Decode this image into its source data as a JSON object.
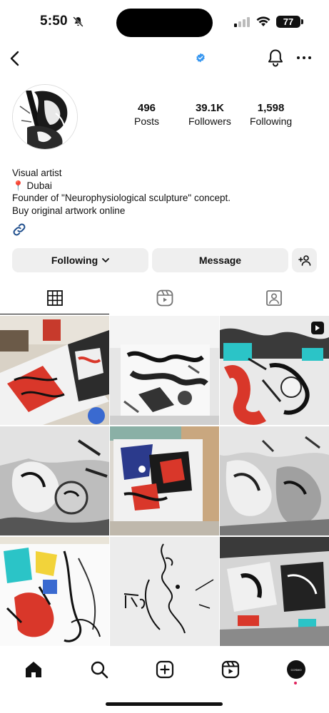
{
  "status_bar": {
    "time": "5:50",
    "battery": "77"
  },
  "profile": {
    "stats": [
      {
        "value": "496",
        "label": "Posts"
      },
      {
        "value": "39.1K",
        "label": "Followers"
      },
      {
        "value": "1,598",
        "label": "Following"
      }
    ],
    "bio": {
      "line1": "Visual artist",
      "line2": "📍 Dubai",
      "line3": "Founder of \"Neurophysiological sculpture\" concept.",
      "line4": "Buy original artwork online"
    }
  },
  "actions": {
    "following_label": "Following",
    "message_label": "Message"
  },
  "tabs": [
    {
      "icon": "grid-icon",
      "selected": true
    },
    {
      "icon": "reels-icon",
      "selected": false
    },
    {
      "icon": "tagged-icon",
      "selected": false
    }
  ],
  "posts_count_visible": 9,
  "bottom_nav": {
    "items": [
      "home-icon",
      "search-icon",
      "create-icon",
      "reels-icon",
      "profile-avatar"
    ],
    "profile_avatar_text": "COSMO"
  },
  "colors": {
    "verified_badge": "#3897f0",
    "button_bg": "#efefef",
    "link_icon": "#1f4e8c",
    "art_red": "#d9372a",
    "art_teal": "#2bc4c7"
  }
}
